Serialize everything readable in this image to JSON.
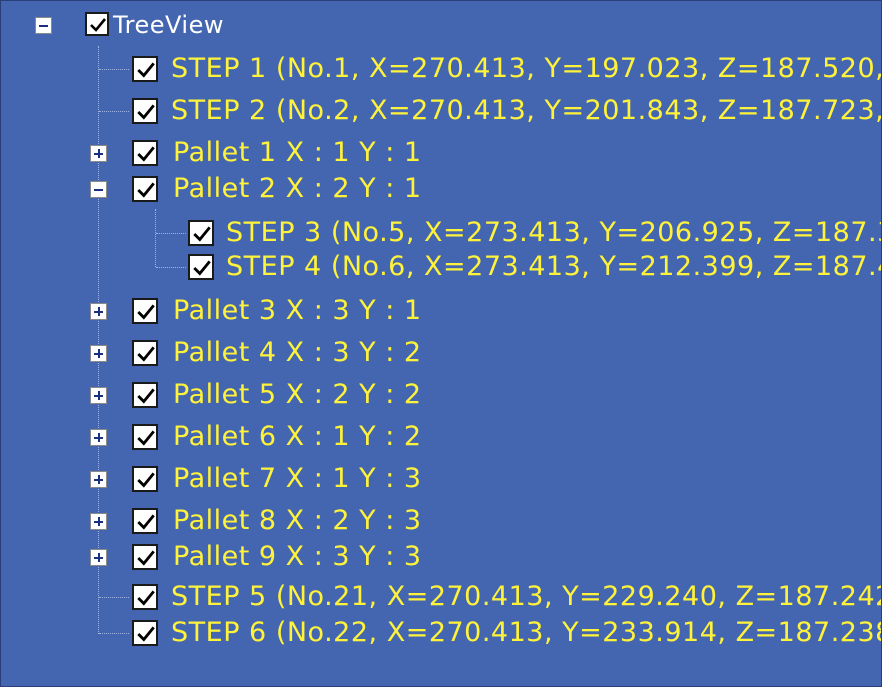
{
  "tree": {
    "root": {
      "label": "TreeView",
      "expanded": true,
      "checked": true
    },
    "items": [
      {
        "label": "STEP 1 (No.1, X=270.413, Y=197.023, Z=187.520,",
        "checked": true,
        "type": "step"
      },
      {
        "label": "STEP 2 (No.2, X=270.413, Y=201.843, Z=187.723,",
        "checked": true,
        "type": "step"
      },
      {
        "label": "Pallet 1 X : 1 Y : 1",
        "checked": true,
        "type": "pallet",
        "expanded": false
      },
      {
        "label": "Pallet 2 X : 2 Y : 1",
        "checked": true,
        "type": "pallet",
        "expanded": true,
        "children": [
          {
            "label": "STEP 3 (No.5, X=273.413, Y=206.925, Z=187.3",
            "checked": true
          },
          {
            "label": "STEP 4 (No.6, X=273.413, Y=212.399, Z=187.4",
            "checked": true
          }
        ]
      },
      {
        "label": "Pallet 3 X : 3 Y : 1",
        "checked": true,
        "type": "pallet",
        "expanded": false
      },
      {
        "label": "Pallet 4 X : 3 Y : 2",
        "checked": true,
        "type": "pallet",
        "expanded": false
      },
      {
        "label": "Pallet 5 X : 2 Y : 2",
        "checked": true,
        "type": "pallet",
        "expanded": false
      },
      {
        "label": "Pallet 6 X : 1 Y : 2",
        "checked": true,
        "type": "pallet",
        "expanded": false
      },
      {
        "label": "Pallet 7 X : 1 Y : 3",
        "checked": true,
        "type": "pallet",
        "expanded": false
      },
      {
        "label": "Pallet 8 X : 2 Y : 3",
        "checked": true,
        "type": "pallet",
        "expanded": false
      },
      {
        "label": "Pallet 9 X : 3 Y : 3",
        "checked": true,
        "type": "pallet",
        "expanded": false
      },
      {
        "label": "STEP 5 (No.21, X=270.413, Y=229.240, Z=187.242,",
        "checked": true,
        "type": "step"
      },
      {
        "label": "STEP 6 (No.22, X=270.413, Y=233.914, Z=187.238,",
        "checked": true,
        "type": "step"
      }
    ]
  },
  "colors": {
    "background": "#4466b0",
    "item_text": "#fff23a",
    "root_text": "#ffffff"
  }
}
